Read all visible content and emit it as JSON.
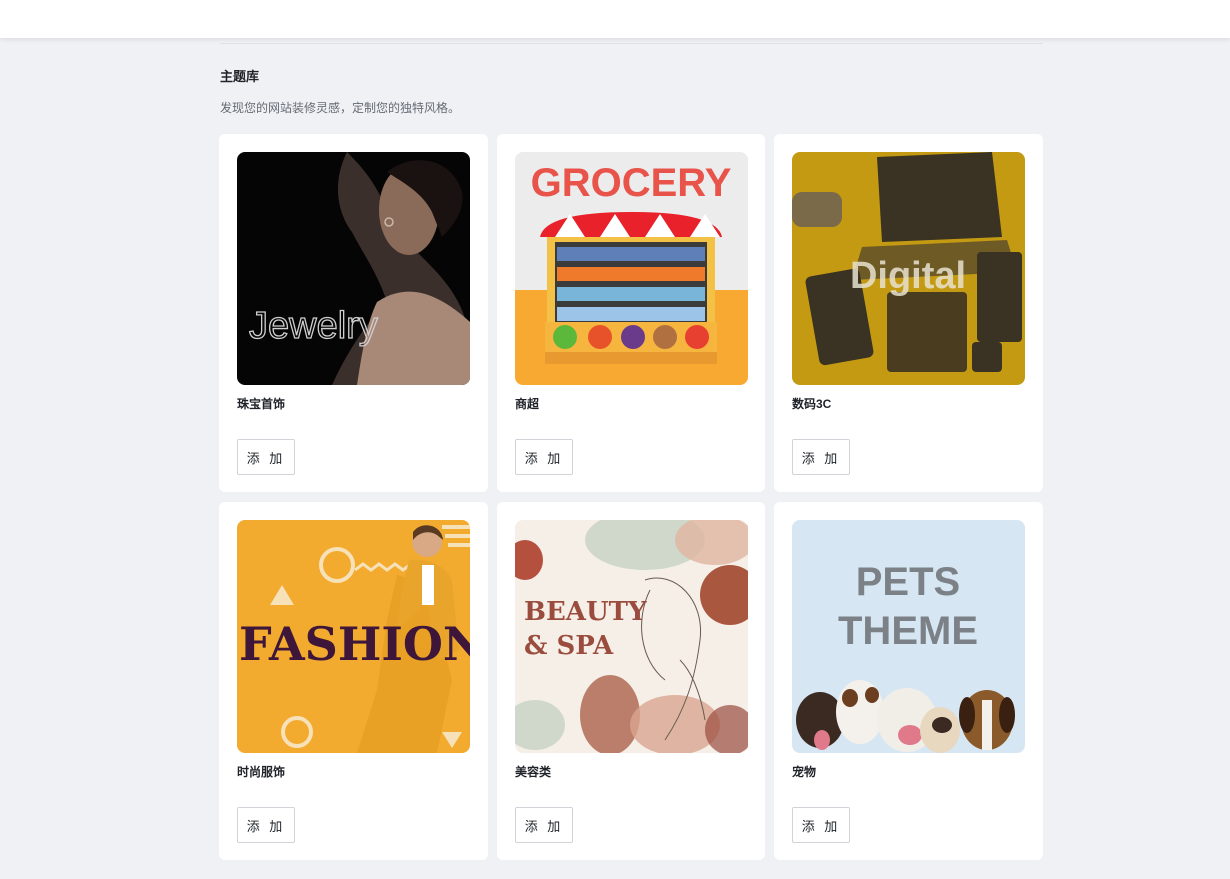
{
  "library": {
    "title": "主题库",
    "description": "发现您的网站装修灵感，定制您的独特风格。"
  },
  "themes": [
    {
      "name": "珠宝首饰",
      "thumb_text": "Jewelry",
      "add_label": "添 加"
    },
    {
      "name": "商超",
      "thumb_text": "GROCERY",
      "add_label": "添 加"
    },
    {
      "name": "数码3C",
      "thumb_text": "Digital",
      "add_label": "添 加"
    },
    {
      "name": "时尚服饰",
      "thumb_text": "FASHION",
      "add_label": "添 加"
    },
    {
      "name": "美容类",
      "thumb_text": "BEAUTY",
      "thumb_text_2": "& SPA",
      "add_label": "添 加"
    },
    {
      "name": "宠物",
      "thumb_text": "PETS",
      "thumb_text_2": "THEME",
      "add_label": "添 加"
    }
  ],
  "colors": {
    "page_bg": "#f0f1f5",
    "card_bg": "#ffffff",
    "jewelry_bg": "#050505",
    "grocery_red": "#e8534a",
    "grocery_orange": "#f7a932",
    "digital_gold": "#c39a12",
    "fashion_yellow": "#f2ab2e",
    "fashion_text": "#3d1639",
    "beauty_bg": "#f6efe8",
    "beauty_text": "#9a4d3e",
    "pets_bg": "#d6e6f2",
    "pets_text": "#7b8187"
  }
}
